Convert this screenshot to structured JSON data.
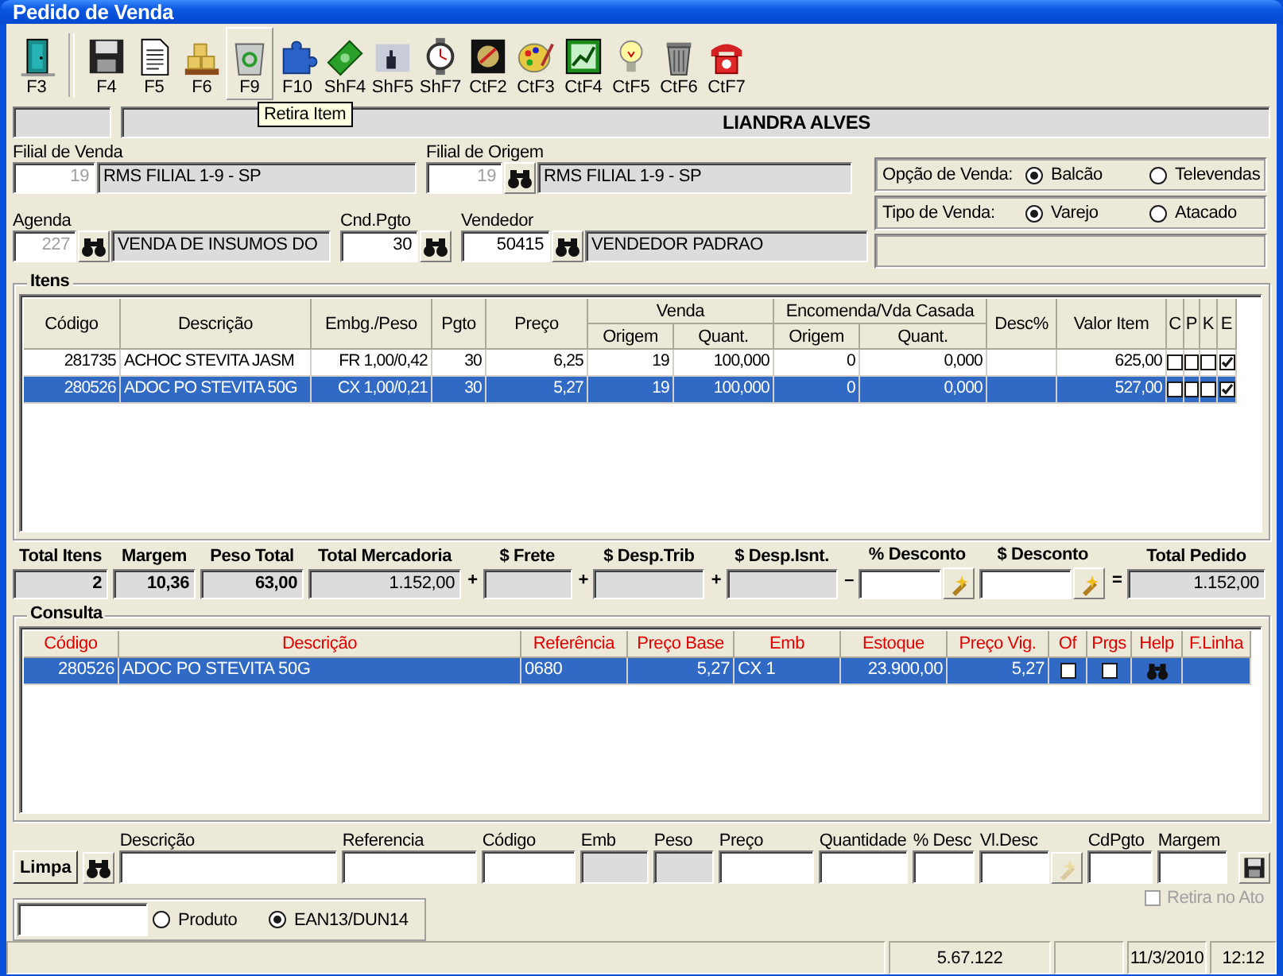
{
  "window": {
    "title": "Pedido de Venda"
  },
  "toolbar": {
    "tooltip": "Retira Item",
    "tools": [
      {
        "key": "F3",
        "hovered": false
      },
      {
        "key": "F4",
        "hovered": false
      },
      {
        "key": "F5",
        "hovered": false
      },
      {
        "key": "F6",
        "hovered": false
      },
      {
        "key": "F9",
        "hovered": true
      },
      {
        "key": "F10",
        "hovered": false
      },
      {
        "key": "ShF4",
        "hovered": false
      },
      {
        "key": "ShF5",
        "hovered": false
      },
      {
        "key": "ShF7",
        "hovered": false
      },
      {
        "key": "CtF2",
        "hovered": false
      },
      {
        "key": "CtF3",
        "hovered": false
      },
      {
        "key": "CtF4",
        "hovered": false
      },
      {
        "key": "CtF5",
        "hovered": false
      },
      {
        "key": "CtF6",
        "hovered": false
      },
      {
        "key": "CtF7",
        "hovered": false
      }
    ]
  },
  "customer_bar": {
    "name": "LIANDRA ALVES"
  },
  "filial_venda": {
    "label": "Filial de Venda",
    "code": "19",
    "disabled": true,
    "name": "RMS FILIAL 1-9 - SP"
  },
  "filial_origem": {
    "label": "Filial de Origem",
    "code": "19",
    "disabled": true,
    "name": "RMS FILIAL 1-9 - SP"
  },
  "opcao_venda": {
    "label": "Opção de Venda:",
    "options": [
      {
        "label": "Balcão",
        "selected": true
      },
      {
        "label": "Televendas",
        "selected": false
      }
    ]
  },
  "tipo_venda": {
    "label": "Tipo de Venda:",
    "options": [
      {
        "label": "Varejo",
        "selected": true
      },
      {
        "label": "Atacado",
        "selected": false
      }
    ]
  },
  "agenda": {
    "label": "Agenda",
    "code": "227",
    "disabled": true,
    "name": "VENDA DE INSUMOS DO"
  },
  "cnd_pgto": {
    "label": "Cnd.Pgto",
    "code": "30",
    "disabled": false
  },
  "vendedor": {
    "label": "Vendedor",
    "code": "50415",
    "disabled": false,
    "name": "VENDEDOR PADRAO"
  },
  "items": {
    "title": "Itens",
    "columns": [
      {
        "label": "Código"
      },
      {
        "label": "Descrição"
      },
      {
        "label": "Embg./Peso"
      },
      {
        "label": "Pgto"
      },
      {
        "label": "Preço"
      },
      {
        "label": "Venda",
        "children": [
          {
            "label": "Origem"
          },
          {
            "label": "Quant."
          }
        ]
      },
      {
        "label": "Encomenda/Vda Casada",
        "children": [
          {
            "label": "Origem"
          },
          {
            "label": "Quant."
          }
        ]
      },
      {
        "label": "Desc%"
      },
      {
        "label": "Valor Item"
      },
      {
        "label": "C"
      },
      {
        "label": "P"
      },
      {
        "label": "K"
      },
      {
        "label": "E"
      }
    ],
    "rows": [
      {
        "codigo": "281735",
        "descricao": "ACHOC STEVITA JASM",
        "embg_peso": "FR 1,00/0,42",
        "pgto": "30",
        "preco": "6,25",
        "venda_origem": "19",
        "venda_quant": "100,000",
        "enc_origem": "0",
        "enc_quant": "0,000",
        "valor_item": "625,00",
        "c": false,
        "p": false,
        "k": false,
        "e": true,
        "selected": false
      },
      {
        "codigo": "280526",
        "descricao": "ADOC PO STEVITA 50G",
        "embg_peso": "CX 1,00/0,21",
        "pgto": "30",
        "preco": "5,27",
        "venda_origem": "19",
        "venda_quant": "100,000",
        "enc_origem": "0",
        "enc_quant": "0,000",
        "valor_item": "527,00",
        "c": false,
        "p": false,
        "k": false,
        "e": true,
        "selected": true
      }
    ]
  },
  "totals": [
    {
      "label": "Total Itens",
      "value": "2",
      "kind": "bold"
    },
    {
      "label": "Margem",
      "value": "10,36",
      "kind": "bold"
    },
    {
      "label": "Peso Total",
      "value": "63,00",
      "kind": "bold"
    },
    {
      "label": "Total Mercadoria",
      "value": "1.152,00",
      "kind": "plain"
    },
    {
      "label": "$ Frete",
      "kind": "plain",
      "operator_before": "+"
    },
    {
      "label": "$ Desp.Trib",
      "kind": "plain",
      "operator_before": "+"
    },
    {
      "label": "$ Desp.Isnt.",
      "kind": "plain",
      "operator_before": "+"
    },
    {
      "label": "% Desconto",
      "kind": "input",
      "operator_before": "–",
      "tool_button": true
    },
    {
      "label": "$ Desconto",
      "kind": "input",
      "tool_button": true
    },
    {
      "label": "Total Pedido",
      "value": "1.152,00",
      "kind": "plain",
      "operator_before": "="
    }
  ],
  "consulta": {
    "title": "Consulta",
    "columns": [
      "Código",
      "Descrição",
      "Referência",
      "Preço Base",
      "Emb",
      "Estoque",
      "Preço Vig.",
      "Of",
      "Prgs",
      "Help",
      "F.Linha"
    ],
    "rows": [
      {
        "codigo": "280526",
        "descricao": "ADOC PO STEVITA 50G",
        "referencia": "0680",
        "preco_base": "5,27",
        "emb": "CX 1",
        "estoque": "23.900,00",
        "preco_vig": "5,27",
        "of": false,
        "prgs": false,
        "selected": true
      }
    ]
  },
  "entry": {
    "clear_button": "Limpa",
    "fields": [
      {
        "label": "Descrição",
        "disabled": false
      },
      {
        "label": "Referencia",
        "disabled": false
      },
      {
        "label": "Código",
        "disabled": false
      },
      {
        "label": "Emb",
        "disabled": true
      },
      {
        "label": "Peso",
        "disabled": true
      },
      {
        "label": "Preço",
        "disabled": false
      },
      {
        "label": "Quantidade",
        "disabled": false
      },
      {
        "label": "% Desc",
        "disabled": false
      },
      {
        "label": "Vl.Desc",
        "disabled": false,
        "tool_button": true
      },
      {
        "label": "CdPgto",
        "disabled": false
      },
      {
        "label": "Margem",
        "disabled": false
      }
    ],
    "retira_no_ato": {
      "label": "Retira no Ato",
      "checked": false,
      "disabled": true
    }
  },
  "search": {
    "options": [
      {
        "label": "Produto",
        "selected": false
      },
      {
        "label": "EAN13/DUN14",
        "selected": true
      }
    ]
  },
  "status_bar": {
    "version": "5.67.122",
    "date": "11/3/2010",
    "time": "12:12"
  }
}
